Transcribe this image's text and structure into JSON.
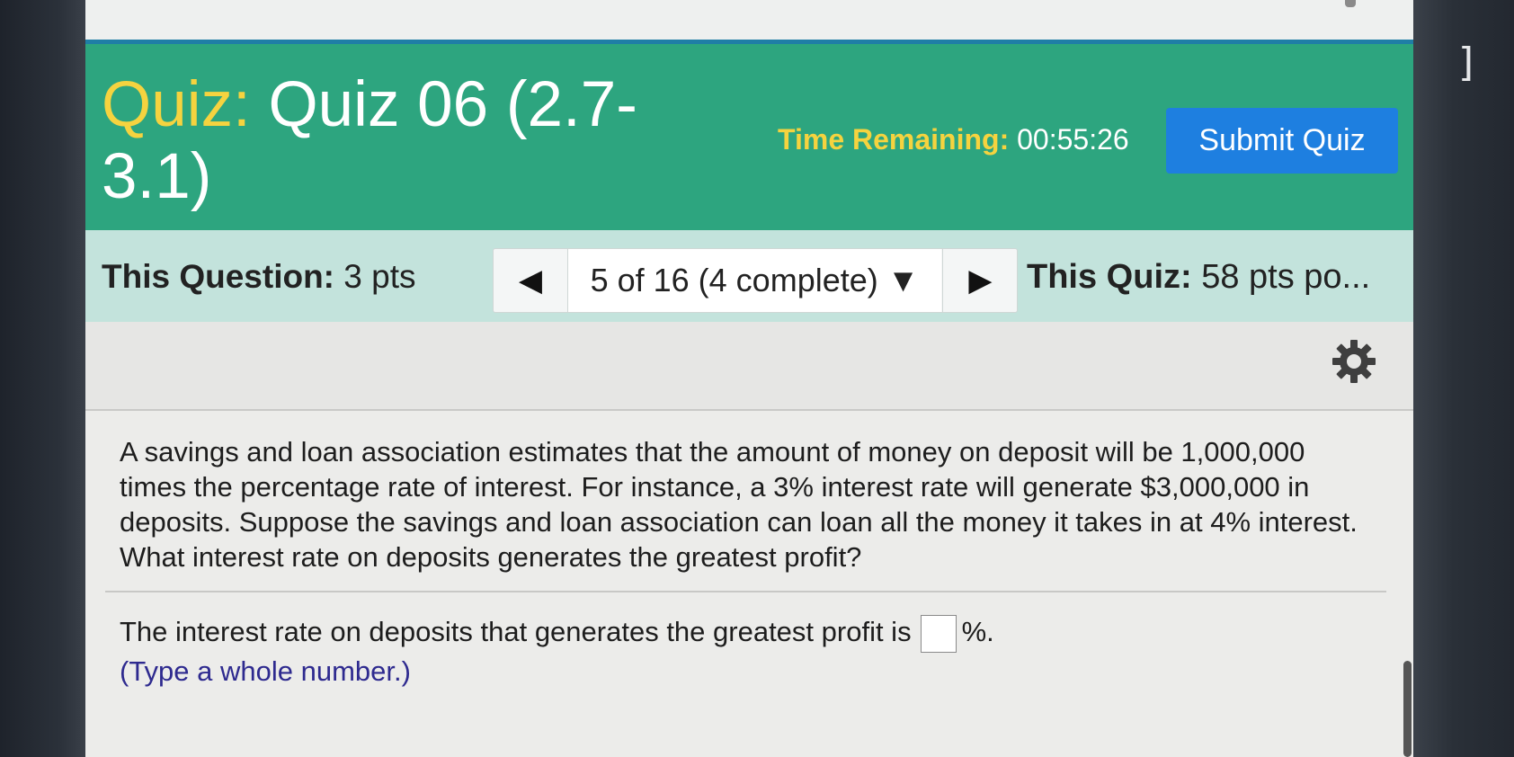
{
  "header": {
    "title_prefix": "Quiz:",
    "title_main": "Quiz 06 (2.7-3.1)",
    "time_label": "Time Remaining:",
    "time_value": "00:55:26",
    "submit_label": "Submit Quiz"
  },
  "nav": {
    "question_label": "This Question:",
    "question_points": "3 pts",
    "prev_icon": "◀",
    "position_text": "5 of 16 (4 complete)",
    "dropdown_icon": "▼",
    "next_icon": "▶",
    "quiz_label": "This Quiz:",
    "quiz_points": "58 pts po..."
  },
  "tools": {
    "settings_icon": "gear-icon"
  },
  "question": {
    "text": "A savings and loan association estimates that the amount of money on deposit will be 1,000,000 times the percentage rate of interest. For instance, a 3% interest rate will generate $3,000,000 in deposits. Suppose the savings and loan association can loan all the money it takes in at 4% interest. What interest rate on deposits generates the greatest profit?",
    "answer_prefix": "The interest rate on deposits that generates the greatest profit is",
    "answer_value": "",
    "answer_suffix": "%.",
    "hint": "(Type a whole number.)"
  },
  "colors": {
    "header_bg": "#2da57f",
    "title_prefix": "#f5d33f",
    "submit_bg": "#1e7fe0",
    "nav_bg": "#c3e3dc",
    "hint_text": "#2e2a8f"
  }
}
